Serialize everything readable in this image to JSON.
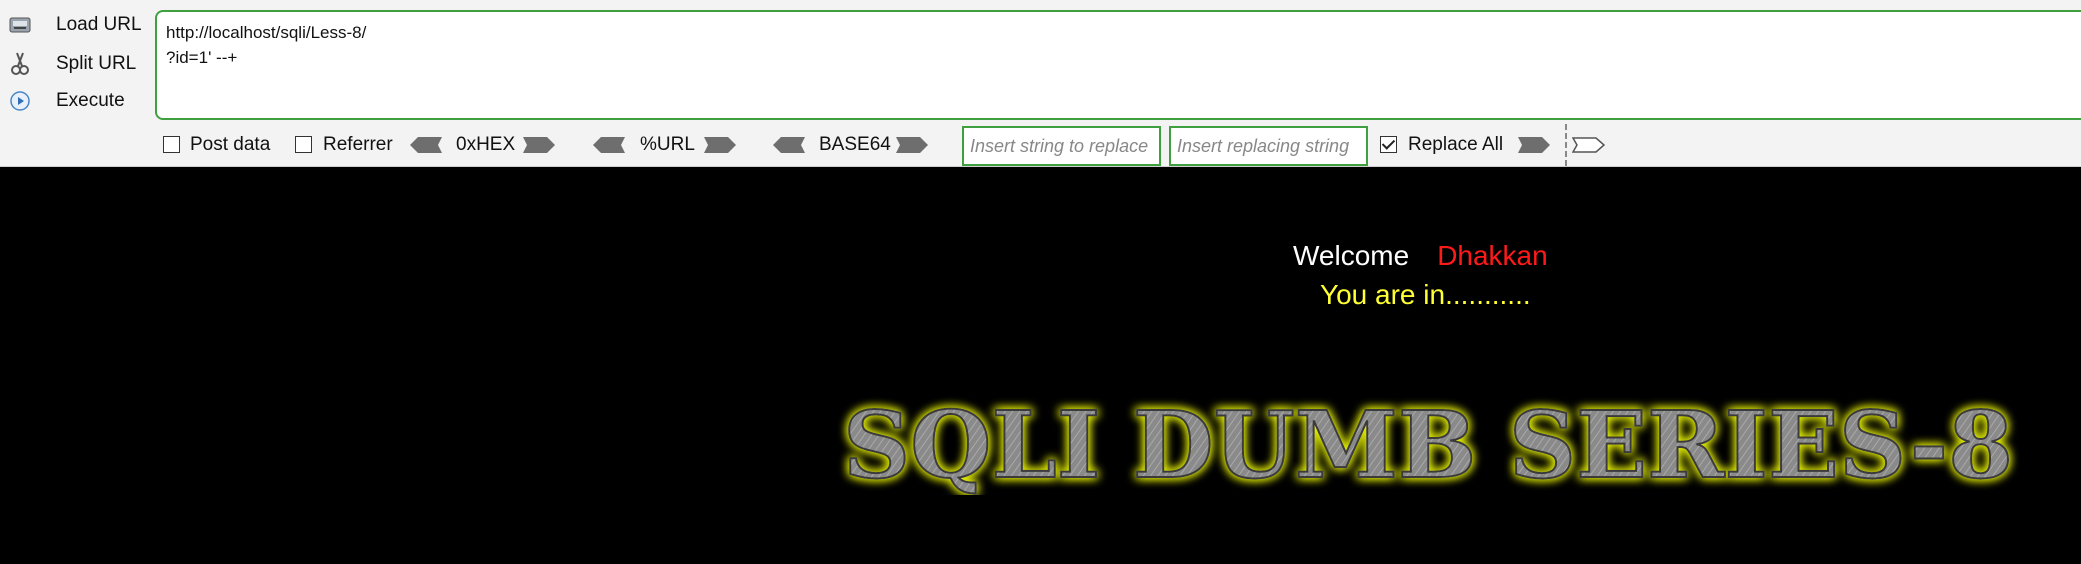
{
  "hackbar": {
    "actions": [
      {
        "label": "Load URL",
        "icon": "load-url-icon"
      },
      {
        "label": "Split URL",
        "icon": "scissors-icon"
      },
      {
        "label": "Execute",
        "icon": "play-icon"
      }
    ],
    "url_text": "http://localhost/sqli/Less-8/\n?id=1' --+",
    "toolbar": {
      "post_data_label": "Post data",
      "post_data_checked": false,
      "referrer_label": "Referrer",
      "referrer_checked": false,
      "hex_label": "0xHEX",
      "url_label": "%URL",
      "base64_label": "BASE64",
      "replace_from_placeholder": "Insert string to replace",
      "replace_to_placeholder": "Insert replacing string",
      "replace_all_label": "Replace All",
      "replace_all_checked": true
    },
    "colors": {
      "accent_border": "#3fa03f",
      "panel_bg": "#f3f3f3"
    }
  },
  "page": {
    "welcome_text": "Welcome",
    "username": "Dhakkan",
    "status_text": "You are in...........",
    "banner_text": "SQLI DUMB SERIES-8",
    "colors": {
      "background": "#000000",
      "welcome": "#ffffff",
      "username": "#ff1a1a",
      "status": "#ffff33",
      "banner_glow": "#e6f000"
    }
  }
}
